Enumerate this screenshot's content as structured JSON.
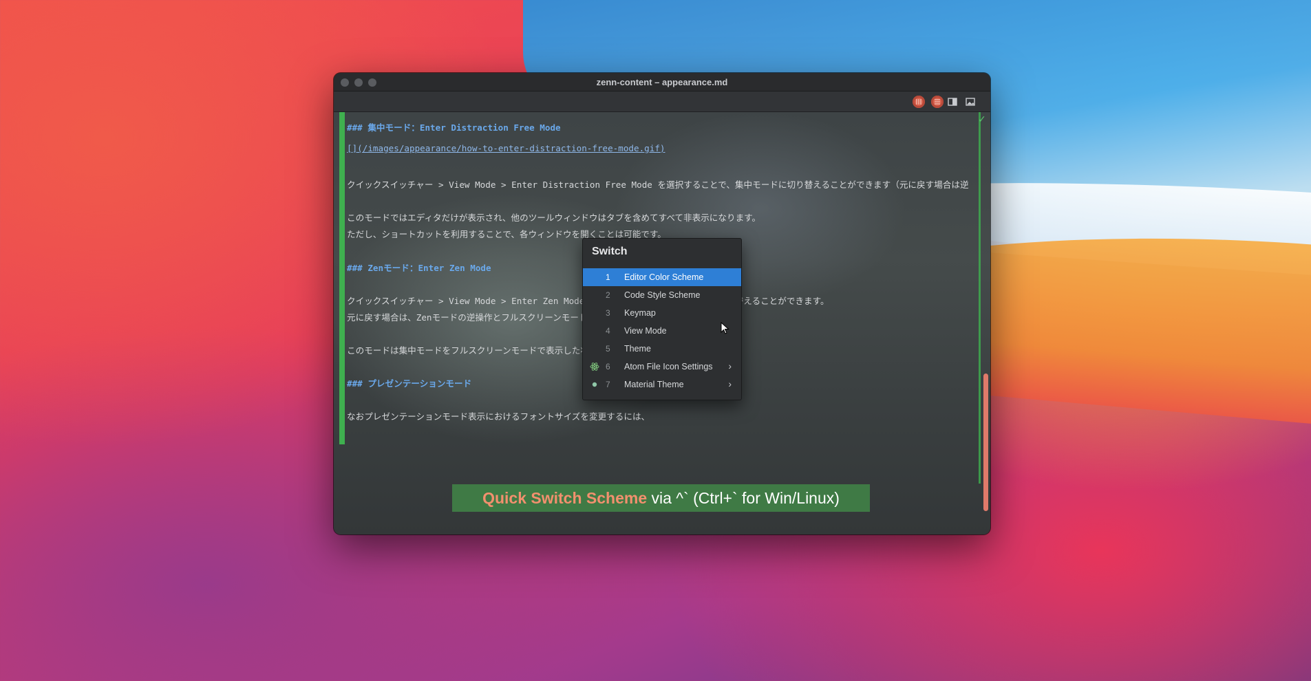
{
  "window": {
    "title": "zenn-content – appearance.md"
  },
  "editor": {
    "lines": [
      {
        "text": "### 集中モード：Enter Distraction Free Mode",
        "kind": "heading"
      },
      {
        "text": " [](/images/appearance/how-to-enter-distraction-free-mode.gif)",
        "kind": "link"
      },
      {
        "text": "クイックスイッチャー > View Mode > Enter Distraction Free Mode を選択することで、集中モードに切り替えることができます（元に戻す場合は逆",
        "kind": "text"
      },
      {
        "text": "このモードではエディタだけが表示され、他のツールウィンドウはタブを含めてすべて非表示になります。",
        "kind": "text"
      },
      {
        "text": "ただし、ショートカットを利用することで、各ウィンドウを開くことは可能です。",
        "kind": "text"
      },
      {
        "text": "### Zenモード：Enter Zen Mode",
        "kind": "heading"
      },
      {
        "text": "クイックスイッチャー > View Mode > Enter Zen Mode を選択することで、Zenモードに切り替えることができます。",
        "kind": "text"
      },
      {
        "text": "元に戻す場合は、Zenモードの逆操作とフルスクリーンモードの解除を行います。",
        "kind": "text"
      },
      {
        "text": "このモードは集中モードをフルスクリーンモードで表示した状態です。",
        "kind": "text"
      },
      {
        "text": "### プレゼンテーションモード",
        "kind": "heading"
      },
      {
        "text": "なおプレゼンテーションモード表示におけるフォントサイズを変更するには、",
        "kind": "text"
      }
    ]
  },
  "switch_popup": {
    "title": "Switch",
    "items": [
      {
        "num": "1",
        "label": "Editor Color Scheme",
        "selected": true,
        "submenu": false,
        "icon": ""
      },
      {
        "num": "2",
        "label": "Code Style Scheme",
        "selected": false,
        "submenu": false,
        "icon": ""
      },
      {
        "num": "3",
        "label": "Keymap",
        "selected": false,
        "submenu": false,
        "icon": ""
      },
      {
        "num": "4",
        "label": "View Mode",
        "selected": false,
        "submenu": false,
        "icon": ""
      },
      {
        "num": "5",
        "label": "Theme",
        "selected": false,
        "submenu": false,
        "icon": ""
      },
      {
        "num": "6",
        "label": "Atom File Icon Settings",
        "selected": false,
        "submenu": true,
        "icon": "atom-icon"
      },
      {
        "num": "7",
        "label": "Material Theme",
        "selected": false,
        "submenu": true,
        "icon": "material-dot-icon"
      }
    ],
    "submenu_arrow": "›"
  },
  "banner": {
    "accent": "Quick Switch Scheme",
    "rest": " via ^` (Ctrl+` for Win/Linux)"
  },
  "colors": {
    "selection": "#2e7fd6",
    "heading": "#6aa8ea",
    "banner_bg": "#3f7a45",
    "banner_accent": "#f2906e",
    "gutter": "#3fb04f",
    "scrollbar": "#e07a6a"
  },
  "icons": {
    "check": "✓"
  }
}
